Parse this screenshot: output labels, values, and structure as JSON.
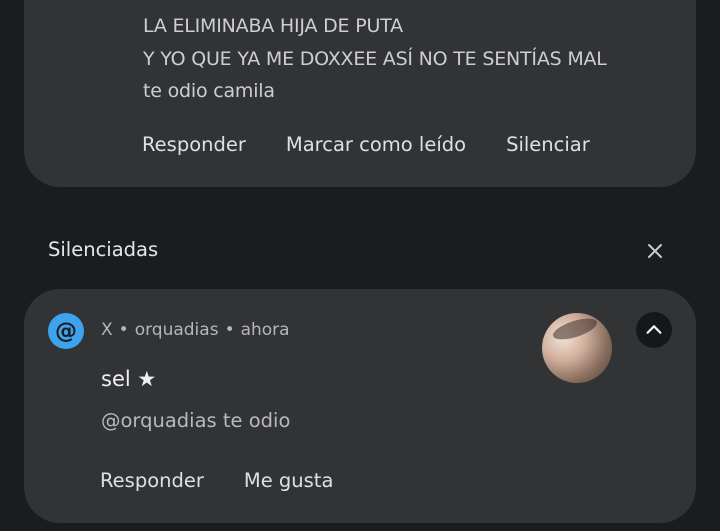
{
  "top_notification": {
    "lines": [
      "LA ELIMINABA HIJA DE PUTA",
      "Y YO QUE YA ME DOXXEE ASÍ NO TE SENTÍAS MAL",
      "te odio camila"
    ],
    "actions": [
      "Responder",
      "Marcar como leído",
      "Silenciar"
    ]
  },
  "silenced_section": {
    "header": "Silenciadas",
    "close_icon": "close-icon"
  },
  "silenced_notification": {
    "app_icon_glyph": "@",
    "app_name": "X",
    "separator": "•",
    "account": "orquadias",
    "time": "ahora",
    "title": "sel ★",
    "body": "@orquadias te odio",
    "actions": [
      "Responder",
      "Me gusta"
    ],
    "accent_color": "#3ea3ee"
  }
}
